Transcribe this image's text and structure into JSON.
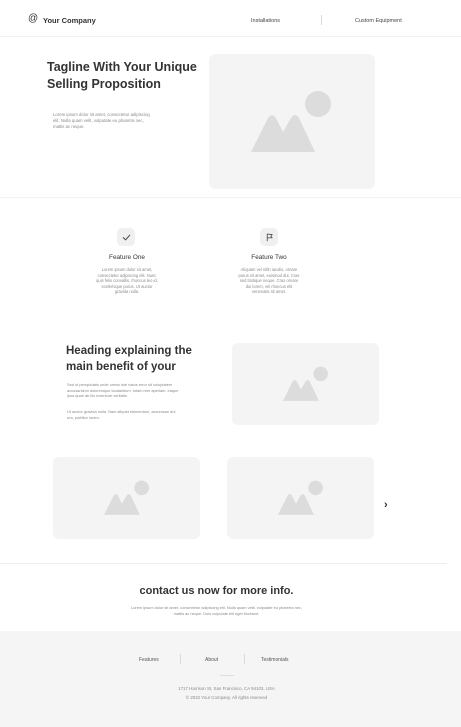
{
  "header": {
    "logo_symbol": "@",
    "company_name": "Your Company",
    "nav": [
      "Installations",
      "Custom Equipment"
    ]
  },
  "hero": {
    "tagline_line1": "Tagline With Your Unique",
    "tagline_line2": "Selling Proposition",
    "body_line1": "Lorem ipsum dolor sit amet, consectetur adipiscing",
    "body_line2": "elit. Nulla quam velit, vulputate eu pharetra nec,",
    "body_line3": "mattis ac neque."
  },
  "features": [
    {
      "icon": "check-icon",
      "title": "Feature One",
      "lines": [
        "Lorem ipsum dolor sit amet,",
        "consectetur adipiscing elit. Nunc",
        "quis felis convallis, rhoncus leo id,",
        "scelerisque purus. Ut auctor",
        "gravida nulla."
      ]
    },
    {
      "icon": "flag-icon",
      "title": "Feature Two",
      "lines": [
        "Aliquam vel nibh iaculis, ornare",
        "purus sit amet, euismod dui. Cras",
        "sed tristique neque. Cras ornare",
        "dui lorem, vel rhoncus elit",
        "venenatis sit amet."
      ]
    }
  ],
  "benefit": {
    "heading_line1": "Heading explaining the",
    "heading_line2": "main benefit of your",
    "para1_line1": "Sed ut perspiciatis unde omnis iste natus error sit voluptatem",
    "para1_line2": "accusantium doloremque laudantium, totam rem aperiam, eaque",
    "para1_line3": "ipsa quae ab illo inventore veritatis.",
    "para2_line1": "Ut auctor gravida nulla. Nam aliquet elementum, accumsan dui",
    "para2_line2": "ura, porttitor lorem."
  },
  "carousel": {
    "next_icon": "chevron-right-icon",
    "next_glyph": "›"
  },
  "contact": {
    "heading": "contact us now for more info.",
    "line1": "Lorem ipsum dolor sit amet, consectetur adipiscing elit. Nulla quam velit, vulputate eu pharetra nec,",
    "line2": "mattis ac neque. Duis vulputate elit eget tincidunt."
  },
  "footer": {
    "links": [
      "Features",
      "About",
      "Testimonials"
    ],
    "address": "1717 Harrison St, San Francisco, CA 94103, USA",
    "copyright": "© 2022 Your Company.  All rights reserved"
  }
}
